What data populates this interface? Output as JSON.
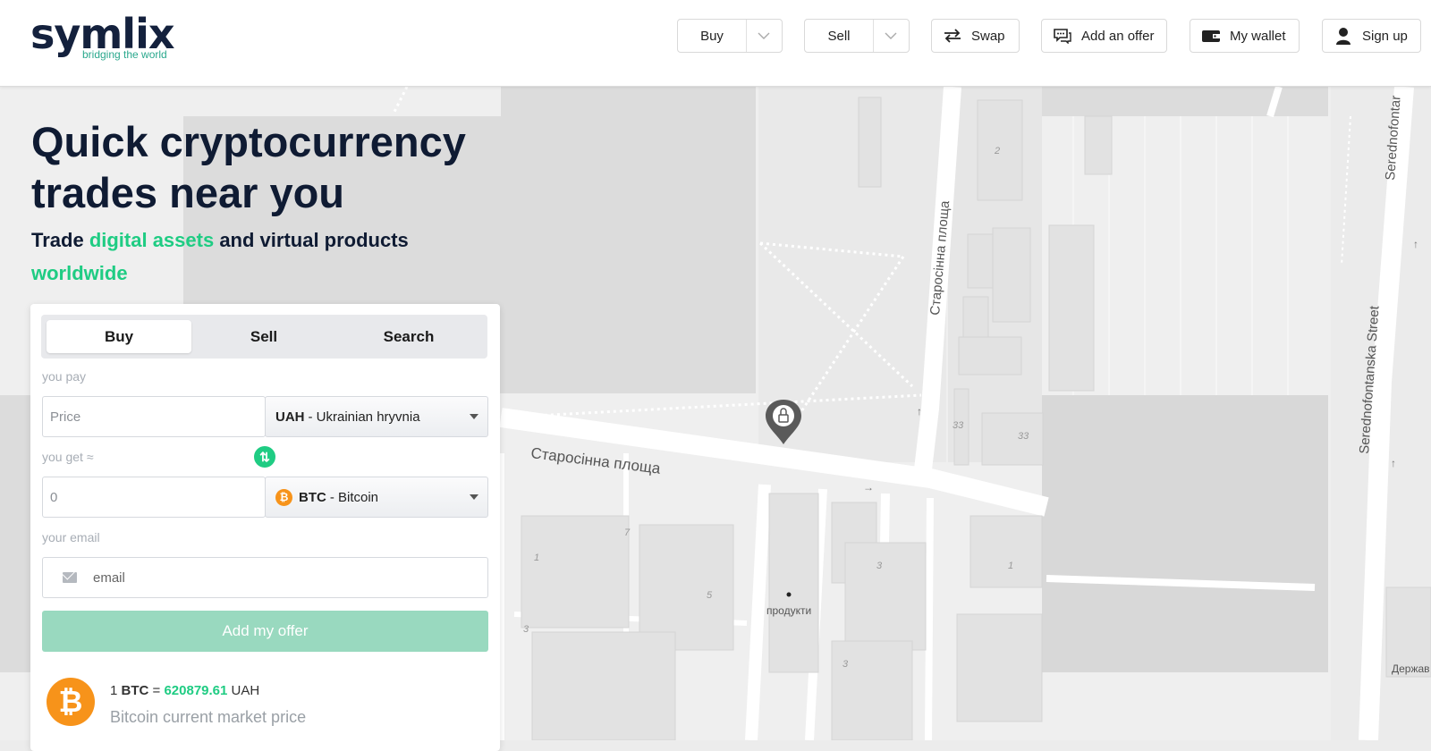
{
  "header": {
    "logo": {
      "name": "symlix",
      "tagline": "bridging the world"
    },
    "nav": {
      "buy": "Buy",
      "sell": "Sell",
      "swap": "Swap",
      "add_offer": "Add an offer",
      "wallet": "My wallet",
      "sign_up": "Sign up"
    }
  },
  "hero": {
    "title": "Quick cryptocurrency trades near you",
    "sub_1": "Trade ",
    "sub_accent_1": "digital assets",
    "sub_2": " and virtual products ",
    "sub_accent_2": "worldwide"
  },
  "form": {
    "tabs": [
      "Buy",
      "Sell",
      "Search"
    ],
    "active_tab": "Buy",
    "pay_label": "you pay",
    "pay_placeholder": "Price",
    "pay_currency_code": "UAH",
    "pay_currency_name": " - Ukrainian hryvnia",
    "get_label": "you get ≈",
    "get_value": "0",
    "get_currency_code": "BTC",
    "get_currency_name": " - Bitcoin",
    "email_label": "your email",
    "email_placeholder": "email",
    "submit": "Add my offer"
  },
  "rate": {
    "prefix": "1 ",
    "asset": "BTC",
    "equals": " = ",
    "value": "620879.61",
    "currency": " UAH",
    "note": "Bitcoin current market price"
  },
  "map": {
    "labels": {
      "square_ua": "Старосінна площа",
      "street_en": "Serednofontanska Street",
      "street_en_top": "Serednofontar",
      "shop": "продукти",
      "state": "Держав",
      "n2": "2",
      "n33a": "33",
      "n33b": "33",
      "n7": "7",
      "n1a": "1",
      "n5": "5",
      "n3a": "3",
      "n3b": "3",
      "n3c": "3",
      "n1b": "1"
    }
  },
  "colors": {
    "accent": "#1fcc83",
    "brand": "#14213d",
    "bitcoin": "#f7931a",
    "submit_disabled": "#99d9bf"
  }
}
